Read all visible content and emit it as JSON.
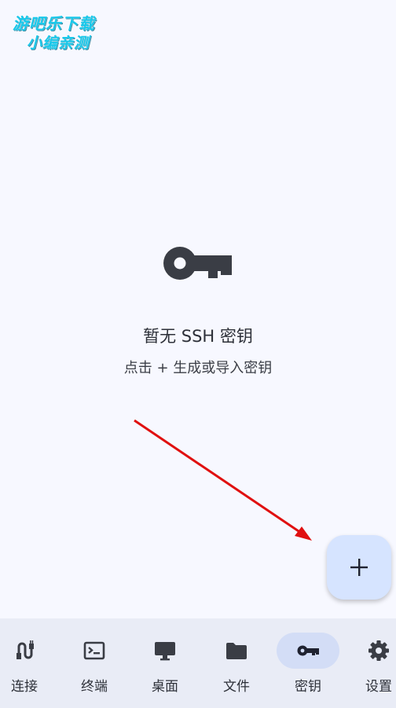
{
  "watermark": {
    "line1": "游吧乐下载",
    "line2": "小编亲测"
  },
  "empty_state": {
    "icon": "key-icon",
    "title": "暂无 SSH 密钥",
    "subtitle": "点击 + 生成或导入密钥"
  },
  "fab": {
    "icon": "plus-icon"
  },
  "nav": {
    "items": [
      {
        "label": "连接",
        "icon": "plug-icon"
      },
      {
        "label": "终端",
        "icon": "terminal-icon"
      },
      {
        "label": "桌面",
        "icon": "monitor-icon"
      },
      {
        "label": "文件",
        "icon": "folder-icon"
      },
      {
        "label": "密钥",
        "icon": "key-icon",
        "active": true
      },
      {
        "label": "设置",
        "icon": "gear-icon"
      }
    ]
  },
  "colors": {
    "background": "#f7f8ff",
    "nav_background": "#e9ecf6",
    "active_pill": "#d3ddf6",
    "fab": "#d6e4ff",
    "icon": "#3a3d45",
    "annotation_arrow": "#e01010"
  }
}
